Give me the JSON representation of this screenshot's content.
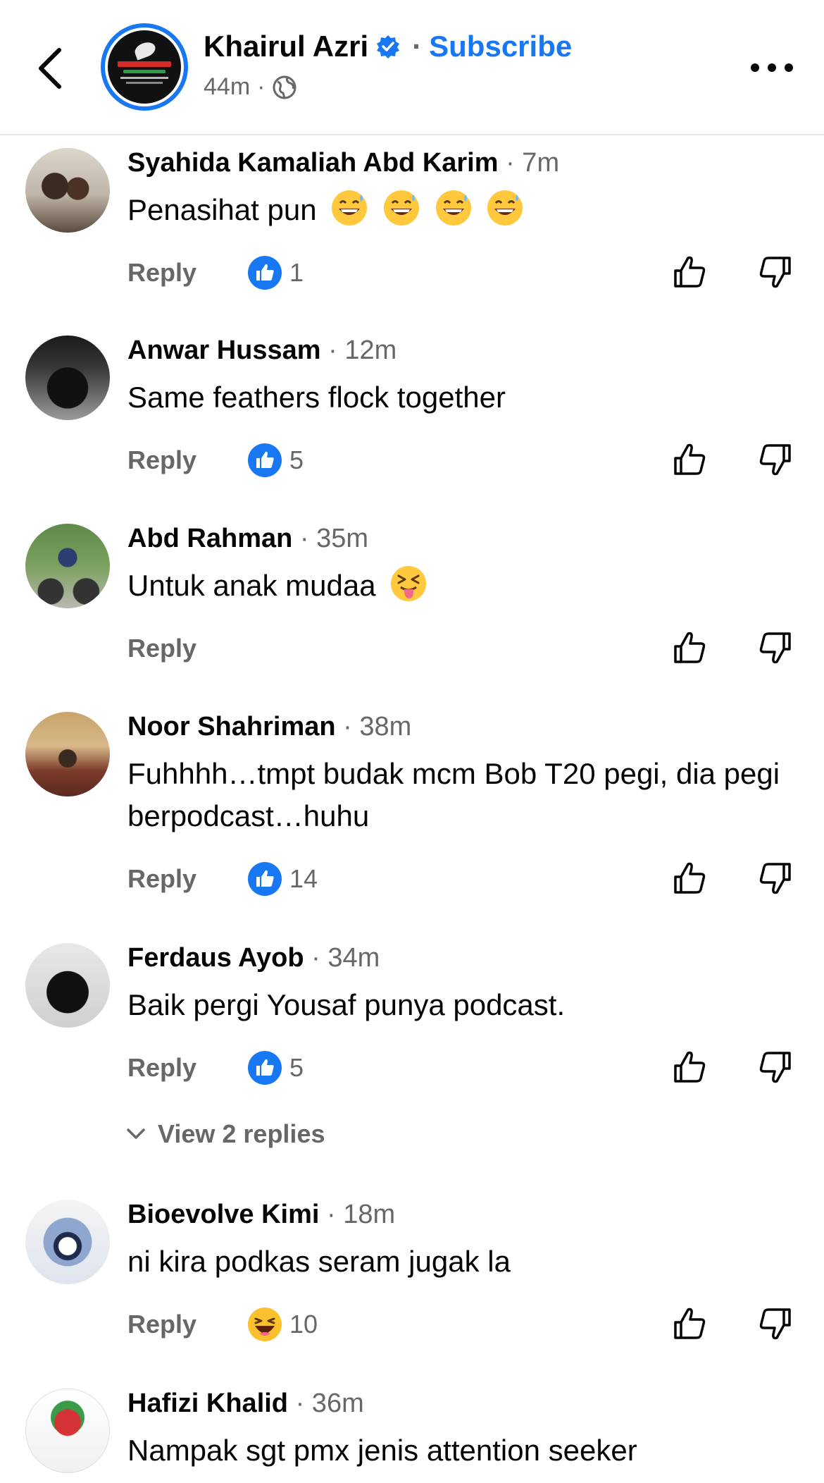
{
  "header": {
    "page_name": "Khairul Azri",
    "separator": "·",
    "subscribe_label": "Subscribe",
    "post_time": "44m",
    "post_time_sep": "·"
  },
  "comments": [
    {
      "author": "Syahida Kamaliah Abd Karim",
      "time": "· 7m",
      "text": "Penasihat pun",
      "emojis": [
        "grinning-sweat-emoji",
        "grinning-sweat-emoji",
        "grinning-sweat-emoji",
        "grinning-sweat-emoji"
      ],
      "reply_label": "Reply",
      "reaction": "like",
      "reaction_count": "1"
    },
    {
      "author": "Anwar Hussam",
      "time": "· 12m",
      "text": "Same feathers flock together",
      "reply_label": "Reply",
      "reaction": "like",
      "reaction_count": "5"
    },
    {
      "author": "Abd Rahman",
      "time": "· 35m",
      "text": "Untuk anak mudaa",
      "emojis": [
        "squinting-tongue-emoji"
      ],
      "reply_label": "Reply"
    },
    {
      "author": "Noor Shahriman",
      "time": "· 38m",
      "text": "Fuhhhh…tmpt budak mcm Bob T20 pegi, dia pegi berpodcast…huhu",
      "reply_label": "Reply",
      "reaction": "like",
      "reaction_count": "14"
    },
    {
      "author": "Ferdaus Ayob",
      "time": "· 34m",
      "text": "Baik pergi Yousaf punya podcast.",
      "reply_label": "Reply",
      "reaction": "like",
      "reaction_count": "5"
    },
    {
      "author": "Bioevolve Kimi",
      "time": "· 18m",
      "text": "ni kira podkas seram jugak la",
      "reply_label": "Reply",
      "reaction": "haha",
      "reaction_count": "10"
    },
    {
      "author": "Hafizi Khalid",
      "time": "· 36m",
      "text": "Nampak sgt pmx jenis attention seeker"
    }
  ],
  "view_replies_label": "View 2 replies",
  "colors": {
    "accent": "#1877f2",
    "secondary_text": "#65676b",
    "divider": "#e4e6eb"
  }
}
